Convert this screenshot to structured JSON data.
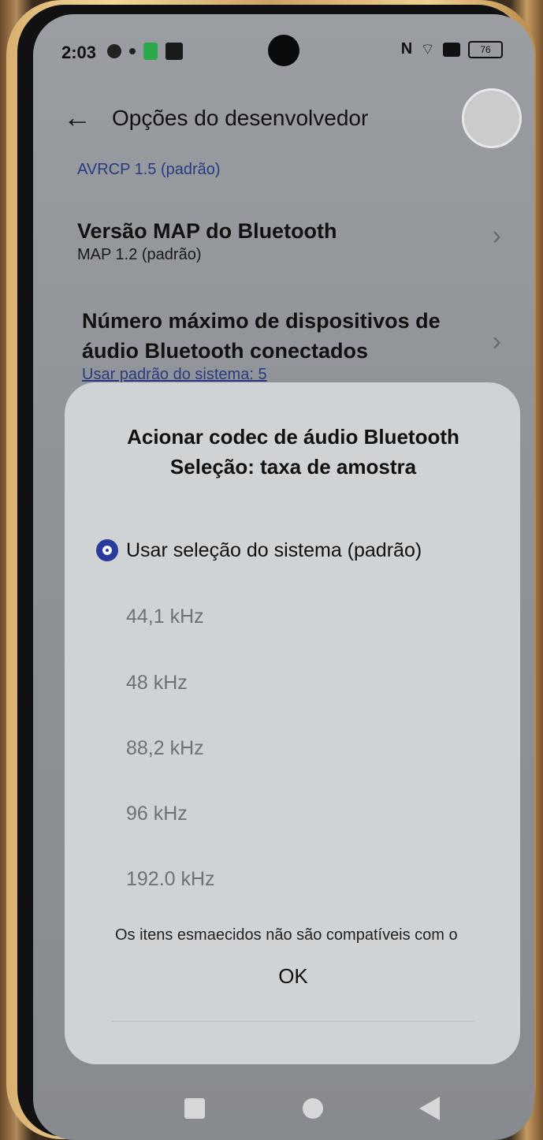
{
  "status_bar": {
    "time": "2:03",
    "battery": "76",
    "icons_left": [
      "steering-wheel-icon",
      "notification-dot-icon",
      "green-app-icon",
      "app-icon"
    ],
    "icons_right": [
      "nfc-icon",
      "wifi-icon",
      "xbox-icon",
      "battery-icon"
    ]
  },
  "header": {
    "title": "Opções do desenvolvedor",
    "back_icon": "back-arrow-icon"
  },
  "settings": [
    {
      "subtitle": "AVRCP 1.5 (padrão)"
    },
    {
      "title": "Versão MAP do Bluetooth",
      "subtitle": "MAP 1.2 (padrão)"
    },
    {
      "title_line1": "Número máximo de dispositivos de",
      "title_line2": "áudio Bluetooth conectados",
      "subtitle": "Usar padrão do sistema: 5"
    }
  ],
  "dialog": {
    "title_line1": "Acionar codec de áudio Bluetooth",
    "title_line2": "Seleção: taxa de amostra",
    "options": [
      {
        "label": "Usar seleção do sistema (padrão)",
        "selected": true,
        "enabled": true
      },
      {
        "label": "44,1 kHz",
        "selected": false,
        "enabled": false
      },
      {
        "label": "48 kHz",
        "selected": false,
        "enabled": false
      },
      {
        "label": "88,2 kHz",
        "selected": false,
        "enabled": false
      },
      {
        "label": "96 kHz",
        "selected": false,
        "enabled": false
      },
      {
        "label": "192.0 kHz",
        "selected": false,
        "enabled": false
      }
    ],
    "note": "Os itens esmaecidos não são compatíveis com o",
    "ok_label": "OK"
  },
  "colors": {
    "accent": "#2a3b9a",
    "dim_text": "#6e7276",
    "dialog_bg": "#d0d3d6"
  }
}
